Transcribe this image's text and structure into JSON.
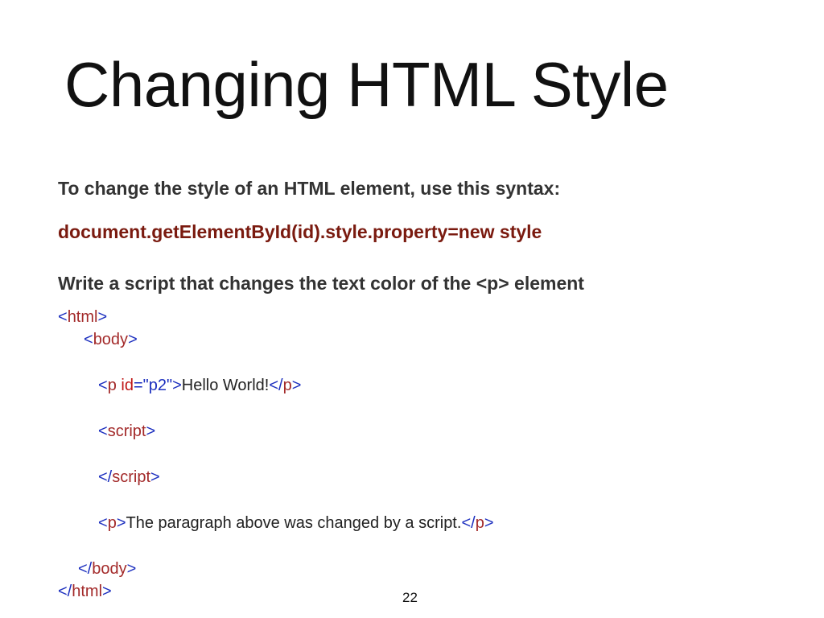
{
  "slide": {
    "title": "Changing HTML Style",
    "intro": "To change the style of an HTML element, use this syntax:",
    "syntax": "document.getElementById(id).style.property=new style",
    "task": "Write a script that changes the text color of the <p> element",
    "page_number": "22"
  },
  "code": {
    "lt": "<",
    "gt": ">",
    "lt_slash": "</",
    "eq": "=",
    "html_tag": "html",
    "body_tag": "body",
    "p_tag": "p",
    "script_tag": "script",
    "id_attr": "id",
    "id_value": "\"p2\"",
    "hello_text": "Hello World!",
    "paragraph_text": "The paragraph above was changed by a script."
  },
  "colors": {
    "syntax_red": "#7a1a0f",
    "code_punct_blue": "#1c2fbf",
    "code_tag_red": "#a32a2a",
    "code_attr_red": "#c01818"
  }
}
